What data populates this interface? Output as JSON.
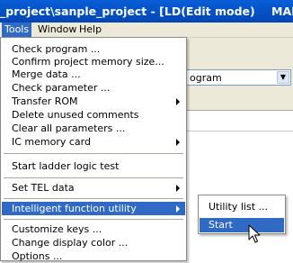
{
  "window": {
    "title": "_project\\sanple_project - [LD(Edit mode)",
    "title_suffix": "MAI"
  },
  "menubar": {
    "tools": "Tools",
    "window": "Window",
    "help": "Help"
  },
  "background": {
    "combo_value": "ogram"
  },
  "tools_menu": {
    "items": [
      {
        "label": "Check program ..."
      },
      {
        "label": "Confirm project memory size..."
      },
      {
        "label": "Merge data ..."
      },
      {
        "label": "Check parameter ..."
      },
      {
        "label": "Transfer ROM"
      },
      {
        "label": "Delete unused comments"
      },
      {
        "label": "Clear all parameters ..."
      },
      {
        "label": "IC memory card"
      },
      {
        "label": "Start ladder logic test"
      },
      {
        "label": "Set TEL data"
      },
      {
        "label": "Intelligent function utility"
      },
      {
        "label": "Customize keys ..."
      },
      {
        "label": "Change display color ..."
      },
      {
        "label": "Options ..."
      }
    ]
  },
  "submenu": {
    "items": [
      {
        "label": "Utility list ..."
      },
      {
        "label": "Start"
      }
    ]
  },
  "colors": {
    "highlight": "#316ac5",
    "titlebar": "#0453c8",
    "menu_bg": "#ffffff",
    "chrome": "#ece9d8"
  },
  "icons": [
    "submenu-arrow-icon",
    "dropdown-arrow-icon",
    "mouse-cursor-icon"
  ]
}
